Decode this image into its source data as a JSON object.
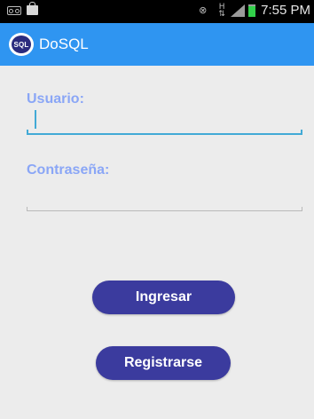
{
  "status_bar": {
    "time": "7:55 PM",
    "icons": [
      "voicemail-icon",
      "shopping-bag-icon",
      "mute-icon",
      "hplus-data-icon",
      "signal-icon",
      "battery-icon"
    ],
    "hplus_text": "H"
  },
  "action_bar": {
    "logo_text": "SQL",
    "title": "DoSQL",
    "color": "#2f95f1"
  },
  "form": {
    "user_label": "Usuario:",
    "user_value": "",
    "password_label": "Contraseña:",
    "password_value": ""
  },
  "buttons": {
    "login_label": "Ingresar",
    "register_label": "Registrarse",
    "color": "#3b3b9e"
  },
  "colors": {
    "label": "#8aa6f6",
    "focused_field": "#42aad6"
  }
}
